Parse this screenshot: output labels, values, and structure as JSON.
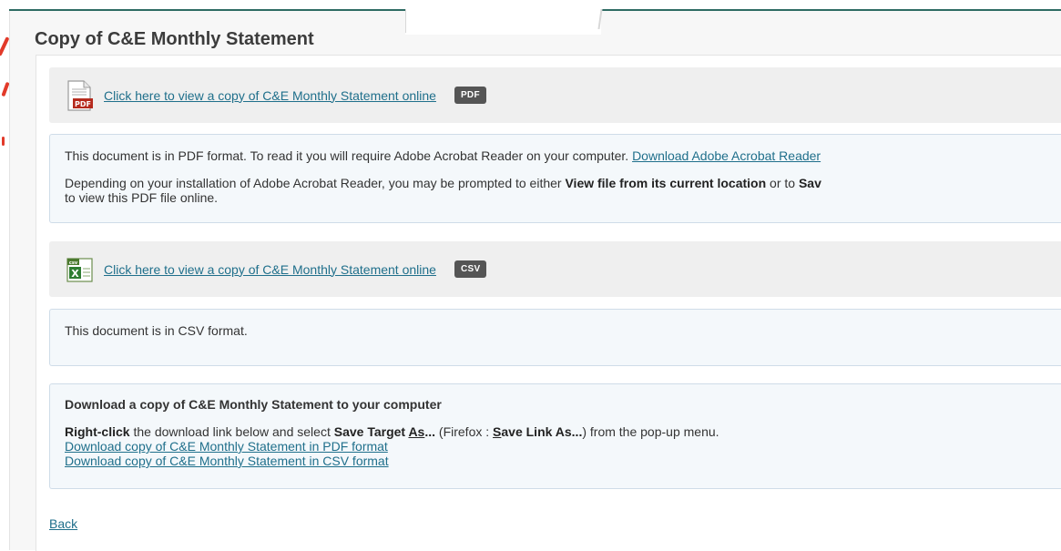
{
  "page": {
    "title": "Copy of C&E Monthly Statement"
  },
  "pdf_section": {
    "link_text": "Click here to view a copy of C&E Monthly Statement online",
    "badge": "PDF",
    "icon": "pdf-file-icon",
    "info_line1": "This document is in PDF format. To read it you will require Adobe Acrobat Reader on your computer. ",
    "info_download_link": "Download Adobe Acrobat Reader",
    "info_line2_a": "Depending on your installation of Adobe Acrobat Reader, you may be prompted to either ",
    "info_line2_bold1": "View file from its current location",
    "info_line2_b": " or to ",
    "info_line2_bold2": "Sav",
    "info_line3": "to view this PDF file online."
  },
  "csv_section": {
    "link_text": "Click here to view a copy of C&E Monthly Statement online",
    "badge": "CSV",
    "icon": "csv-file-icon",
    "info_line1": "This document is in CSV format."
  },
  "download_section": {
    "heading": "Download a copy of C&E Monthly Statement to your computer",
    "instr_bold1": "Right-click",
    "instr_a": " the download link below and select ",
    "instr_bold2": "Save Target ",
    "instr_bold2_u": "As",
    "instr_bold2_end": "...",
    "instr_b": " (Firefox : ",
    "instr_bold3_u": "S",
    "instr_bold3": "ave Link As...",
    "instr_c": ") from the pop-up menu.",
    "link_pdf": "Download copy of C&E Monthly Statement in PDF format",
    "link_csv": "Download copy of C&E Monthly Statement in CSV format"
  },
  "back_label": "Back",
  "colors": {
    "link": "#1f6f8b",
    "badge_bg": "#555555",
    "accent_line": "#2e6b63"
  }
}
